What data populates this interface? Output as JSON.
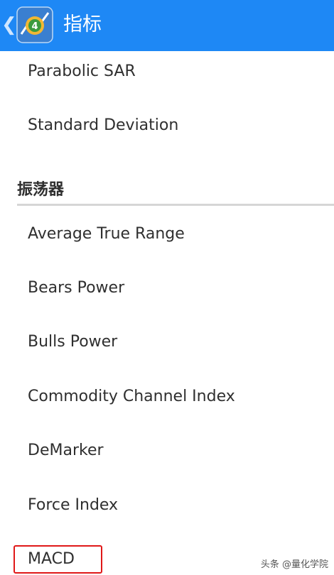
{
  "header": {
    "title": "指标",
    "back_icon": "chevron-left-icon",
    "app_icon": "metatrader-4-icon",
    "background_color": "#1e88f5"
  },
  "list": {
    "items_top": [
      "Parabolic SAR",
      "Standard Deviation"
    ],
    "section": {
      "title": "振荡器",
      "items": [
        "Average True Range",
        "Bears Power",
        "Bulls Power",
        "Commodity Channel Index",
        "DeMarker",
        "Force Index",
        "MACD"
      ]
    },
    "highlighted_item": "MACD",
    "highlight_color": "#e01818"
  },
  "watermark": "头条 @量化学院"
}
